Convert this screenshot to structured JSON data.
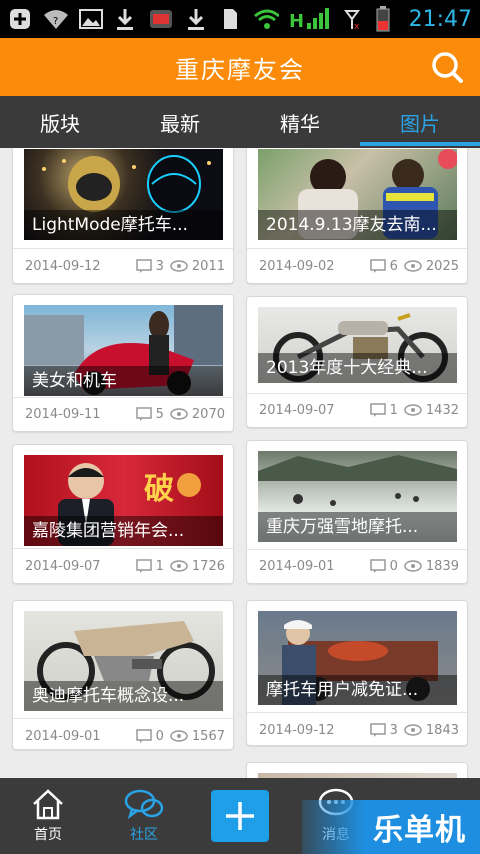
{
  "status": {
    "time": "21:47",
    "signal_label": "H"
  },
  "header": {
    "title": "重庆摩友会"
  },
  "tabs": [
    {
      "label": "版块"
    },
    {
      "label": "最新"
    },
    {
      "label": "精华"
    },
    {
      "label": "图片"
    }
  ],
  "active_tab": "图片",
  "cards": [
    {
      "caption": "LightMode摩托车...",
      "date": "2014-09-12",
      "comments": "3",
      "views": "2011"
    },
    {
      "caption": "2014.9.13摩友去南...",
      "date": "2014-09-02",
      "comments": "6",
      "views": "2025"
    },
    {
      "caption": "美女和机车",
      "date": "2014-09-11",
      "comments": "5",
      "views": "2070"
    },
    {
      "caption": "2013年度十大经典...",
      "date": "2014-09-07",
      "comments": "1",
      "views": "1432"
    },
    {
      "caption": "嘉陵集团营销年会...",
      "date": "2014-09-07",
      "comments": "1",
      "views": "1726"
    },
    {
      "caption": "重庆万强雪地摩托...",
      "date": "2014-09-01",
      "comments": "0",
      "views": "1839"
    },
    {
      "caption": "奥迪摩托车概念设...",
      "date": "2014-09-01",
      "comments": "0",
      "views": "1567"
    },
    {
      "caption": "摩托车用户减免证...",
      "date": "2014-09-12",
      "comments": "3",
      "views": "1843"
    }
  ],
  "bottom_nav": [
    {
      "label": "首页",
      "icon": "home-icon"
    },
    {
      "label": "社区",
      "icon": "chat-bubbles-icon"
    },
    {
      "label": "",
      "icon": "plus-icon"
    },
    {
      "label": "消息",
      "icon": "message-icon"
    },
    {
      "label": "",
      "icon": "book-icon"
    }
  ],
  "watermark": "乐单机",
  "colors": {
    "accent": "#fb8b0a",
    "tab_active": "#2aa3e6",
    "nav_bg": "#3b3b3b"
  }
}
